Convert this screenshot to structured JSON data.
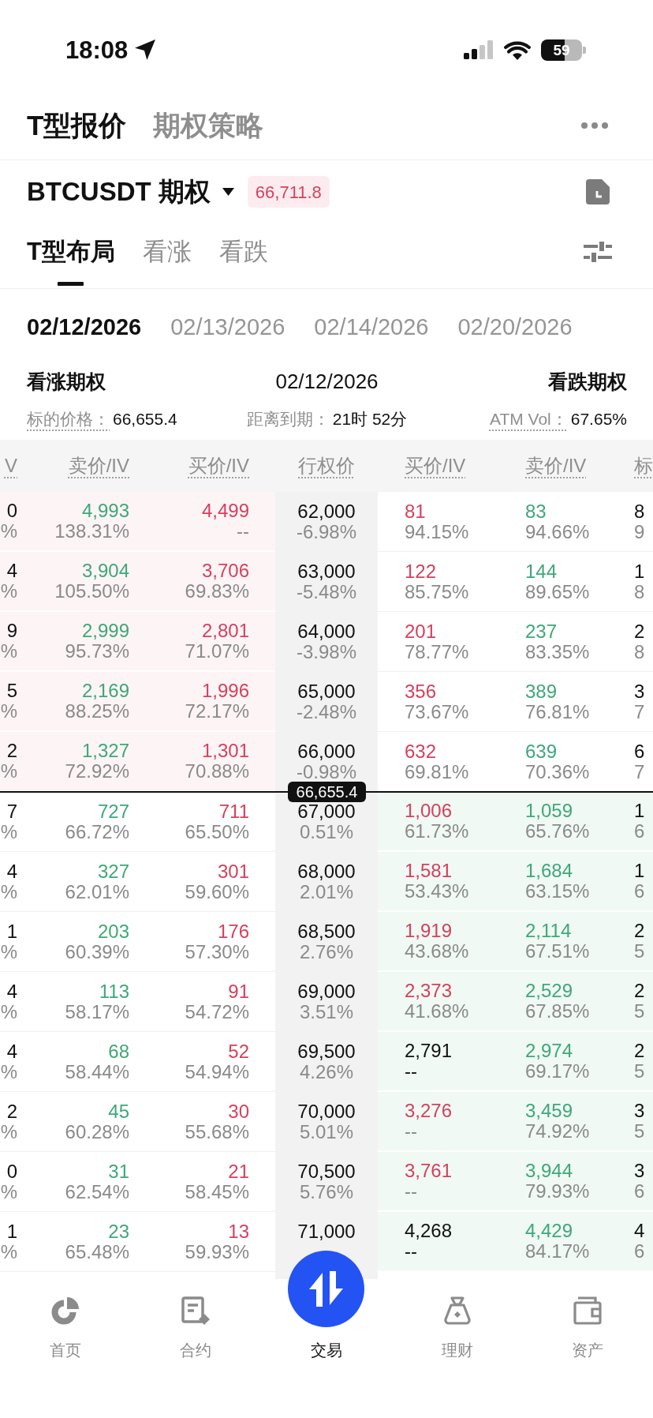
{
  "status_bar": {
    "time": "18:08",
    "battery": "59"
  },
  "header": {
    "tabs": [
      {
        "label": "T型报价",
        "selected": true
      },
      {
        "label": "期权策略",
        "selected": false
      }
    ]
  },
  "instrument": {
    "name": "BTCUSDT 期权",
    "price": "66,711.8"
  },
  "view_tabs": [
    {
      "label": "T型布局",
      "selected": true
    },
    {
      "label": "看涨",
      "selected": false
    },
    {
      "label": "看跌",
      "selected": false
    }
  ],
  "expiry_tabs": [
    {
      "label": "02/12/2026",
      "selected": true
    },
    {
      "label": "02/13/2026",
      "selected": false
    },
    {
      "label": "02/14/2026",
      "selected": false
    },
    {
      "label": "02/20/2026",
      "selected": false
    }
  ],
  "summary": {
    "left": "看涨期权",
    "center": "02/12/2026",
    "right": "看跌期权",
    "stats": [
      {
        "label": "标的价格：",
        "value": "66,655.4",
        "underlined": true
      },
      {
        "label": "距离到期：",
        "value": "21时 52分",
        "underlined": false
      },
      {
        "label": "ATM Vol：",
        "value": "67.65%",
        "underlined": true
      }
    ]
  },
  "table": {
    "columns": [
      "V",
      "卖价/IV",
      "买价/IV",
      "行权价",
      "买价/IV",
      "卖价/IV",
      "标"
    ],
    "rows": [
      {
        "kind": "quote",
        "call_in_money": true,
        "put_in_money": false,
        "column_1": [
          "0",
          "%"
        ],
        "call_ask": {
          "price": "4,993",
          "iv": "138.31%"
        },
        "call_bid": {
          "price": "4,499",
          "iv": "--"
        },
        "strike": "62,000",
        "change": "-6.98%",
        "put_bid": {
          "price": "81",
          "iv": "94.15%",
          "stale": false
        },
        "put_ask": {
          "price": "83",
          "iv": "94.66%"
        },
        "column_7": [
          "8",
          "9"
        ]
      },
      {
        "kind": "quote",
        "call_in_money": true,
        "put_in_money": false,
        "column_1": [
          "4",
          "%"
        ],
        "call_ask": {
          "price": "3,904",
          "iv": "105.50%"
        },
        "call_bid": {
          "price": "3,706",
          "iv": "69.83%"
        },
        "strike": "63,000",
        "change": "-5.48%",
        "put_bid": {
          "price": "122",
          "iv": "85.75%",
          "stale": false
        },
        "put_ask": {
          "price": "144",
          "iv": "89.65%"
        },
        "column_7": [
          "1",
          "8"
        ]
      },
      {
        "kind": "quote",
        "call_in_money": true,
        "put_in_money": false,
        "column_1": [
          "9",
          "%"
        ],
        "call_ask": {
          "price": "2,999",
          "iv": "95.73%"
        },
        "call_bid": {
          "price": "2,801",
          "iv": "71.07%"
        },
        "strike": "64,000",
        "change": "-3.98%",
        "put_bid": {
          "price": "201",
          "iv": "78.77%",
          "stale": false
        },
        "put_ask": {
          "price": "237",
          "iv": "83.35%"
        },
        "column_7": [
          "2",
          "8"
        ]
      },
      {
        "kind": "quote",
        "call_in_money": true,
        "put_in_money": false,
        "column_1": [
          "5",
          "%"
        ],
        "call_ask": {
          "price": "2,169",
          "iv": "88.25%"
        },
        "call_bid": {
          "price": "1,996",
          "iv": "72.17%"
        },
        "strike": "65,000",
        "change": "-2.48%",
        "put_bid": {
          "price": "356",
          "iv": "73.67%",
          "stale": false
        },
        "put_ask": {
          "price": "389",
          "iv": "76.81%"
        },
        "column_7": [
          "3",
          "7"
        ]
      },
      {
        "kind": "quote",
        "call_in_money": true,
        "put_in_money": false,
        "column_1": [
          "2",
          "%"
        ],
        "call_ask": {
          "price": "1,327",
          "iv": "72.92%"
        },
        "call_bid": {
          "price": "1,301",
          "iv": "70.88%"
        },
        "strike": "66,000",
        "change": "-0.98%",
        "put_bid": {
          "price": "632",
          "iv": "69.81%",
          "stale": false
        },
        "put_ask": {
          "price": "639",
          "iv": "70.36%"
        },
        "column_7": [
          "6",
          "7"
        ]
      },
      {
        "kind": "marker",
        "label": "66,655.4"
      },
      {
        "kind": "quote",
        "call_in_money": false,
        "put_in_money": true,
        "column_1": [
          "7",
          "%"
        ],
        "call_ask": {
          "price": "727",
          "iv": "66.72%"
        },
        "call_bid": {
          "price": "711",
          "iv": "65.50%"
        },
        "strike": "67,000",
        "change": "0.51%",
        "put_bid": {
          "price": "1,006",
          "iv": "61.73%",
          "stale": false
        },
        "put_ask": {
          "price": "1,059",
          "iv": "65.76%"
        },
        "column_7": [
          "1",
          "6"
        ]
      },
      {
        "kind": "quote",
        "call_in_money": false,
        "put_in_money": true,
        "column_1": [
          "4",
          "%"
        ],
        "call_ask": {
          "price": "327",
          "iv": "62.01%"
        },
        "call_bid": {
          "price": "301",
          "iv": "59.60%"
        },
        "strike": "68,000",
        "change": "2.01%",
        "put_bid": {
          "price": "1,581",
          "iv": "53.43%",
          "stale": false
        },
        "put_ask": {
          "price": "1,684",
          "iv": "63.15%"
        },
        "column_7": [
          "1",
          "6"
        ]
      },
      {
        "kind": "quote",
        "call_in_money": false,
        "put_in_money": true,
        "column_1": [
          "1",
          "%"
        ],
        "call_ask": {
          "price": "203",
          "iv": "60.39%"
        },
        "call_bid": {
          "price": "176",
          "iv": "57.30%"
        },
        "strike": "68,500",
        "change": "2.76%",
        "put_bid": {
          "price": "1,919",
          "iv": "43.68%",
          "stale": false
        },
        "put_ask": {
          "price": "2,114",
          "iv": "67.51%"
        },
        "column_7": [
          "2",
          "5"
        ]
      },
      {
        "kind": "quote",
        "call_in_money": false,
        "put_in_money": true,
        "column_1": [
          "4",
          "%"
        ],
        "call_ask": {
          "price": "113",
          "iv": "58.17%"
        },
        "call_bid": {
          "price": "91",
          "iv": "54.72%"
        },
        "strike": "69,000",
        "change": "3.51%",
        "put_bid": {
          "price": "2,373",
          "iv": "41.68%",
          "stale": false
        },
        "put_ask": {
          "price": "2,529",
          "iv": "67.85%"
        },
        "column_7": [
          "2",
          "5"
        ]
      },
      {
        "kind": "quote",
        "call_in_money": false,
        "put_in_money": true,
        "column_1": [
          "4",
          "%"
        ],
        "call_ask": {
          "price": "68",
          "iv": "58.44%"
        },
        "call_bid": {
          "price": "52",
          "iv": "54.94%"
        },
        "strike": "69,500",
        "change": "4.26%",
        "put_bid": {
          "price": "2,791",
          "iv": "--",
          "stale": true
        },
        "put_ask": {
          "price": "2,974",
          "iv": "69.17%"
        },
        "column_7": [
          "2",
          "5"
        ]
      },
      {
        "kind": "quote",
        "call_in_money": false,
        "put_in_money": true,
        "column_1": [
          "2",
          "%"
        ],
        "call_ask": {
          "price": "45",
          "iv": "60.28%"
        },
        "call_bid": {
          "price": "30",
          "iv": "55.68%"
        },
        "strike": "70,000",
        "change": "5.01%",
        "put_bid": {
          "price": "3,276",
          "iv": "--",
          "stale": false
        },
        "put_ask": {
          "price": "3,459",
          "iv": "74.92%"
        },
        "column_7": [
          "3",
          "5"
        ]
      },
      {
        "kind": "quote",
        "call_in_money": false,
        "put_in_money": true,
        "column_1": [
          "0",
          "%"
        ],
        "call_ask": {
          "price": "31",
          "iv": "62.54%"
        },
        "call_bid": {
          "price": "21",
          "iv": "58.45%"
        },
        "strike": "70,500",
        "change": "5.76%",
        "put_bid": {
          "price": "3,761",
          "iv": "--",
          "stale": false
        },
        "put_ask": {
          "price": "3,944",
          "iv": "79.93%"
        },
        "column_7": [
          "3",
          "6"
        ]
      },
      {
        "kind": "quote",
        "call_in_money": false,
        "put_in_money": true,
        "column_1": [
          "1",
          "%"
        ],
        "call_ask": {
          "price": "23",
          "iv": "65.48%"
        },
        "call_bid": {
          "price": "13",
          "iv": "59.93%"
        },
        "strike": "71,000",
        "put_bid": {
          "price": "4,268",
          "iv": "--",
          "stale": true
        },
        "put_ask": {
          "price": "4,429",
          "iv": "84.17%"
        },
        "column_7": [
          "4",
          "6"
        ]
      }
    ]
  },
  "bottom_nav": [
    {
      "label": "首页",
      "selected": false
    },
    {
      "label": "合约",
      "selected": false
    },
    {
      "label": "交易",
      "selected": true
    },
    {
      "label": "理财",
      "selected": false
    },
    {
      "label": "资产",
      "selected": false
    }
  ]
}
